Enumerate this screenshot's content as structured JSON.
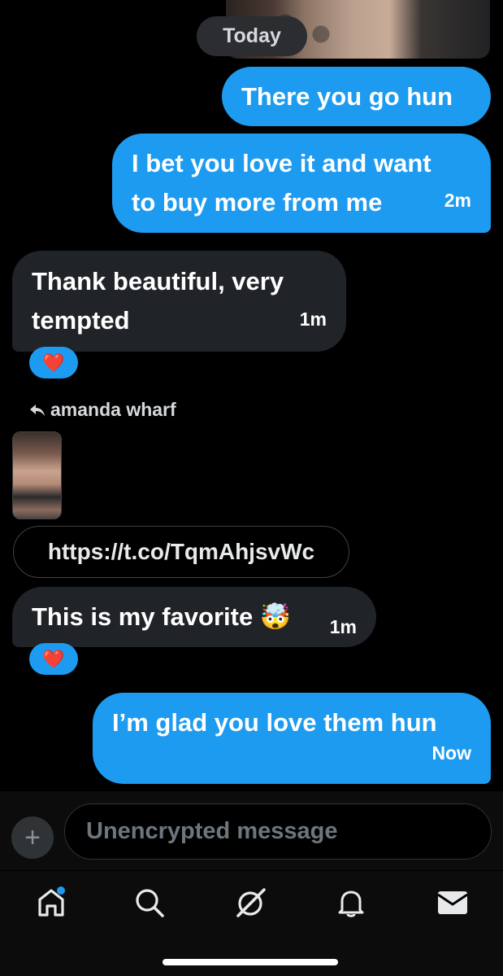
{
  "conversation": {
    "date_label": "Today",
    "messages": [
      {
        "text_lines": [
          "There you go hun"
        ],
        "time": ""
      },
      {
        "text_lines": [
          "I bet you love it and want",
          "to buy more from me"
        ],
        "time": "2m"
      },
      {
        "text_lines": [
          "Thank beautiful, very",
          "tempted"
        ],
        "time": "1m",
        "reaction": "❤️"
      },
      {
        "reply_to": "amanda wharf"
      },
      {
        "link": "https://t.co/TqmAhjsvWc"
      },
      {
        "text": "This is my favorite 🤯",
        "time": "1m",
        "reaction": "❤️"
      },
      {
        "text": "I’m glad you love them hun",
        "time": "Now"
      }
    ]
  },
  "composer": {
    "placeholder": "Unencrypted message",
    "add_label": "+"
  },
  "tabbar": {
    "items": [
      {
        "icon": "home-icon",
        "has_badge": true
      },
      {
        "icon": "search-icon"
      },
      {
        "icon": "grok-icon"
      },
      {
        "icon": "bell-icon"
      },
      {
        "icon": "mail-icon"
      }
    ]
  },
  "colors": {
    "accent": "#1d9bf0",
    "incoming": "#202327",
    "badge": "#1d9bf0"
  }
}
